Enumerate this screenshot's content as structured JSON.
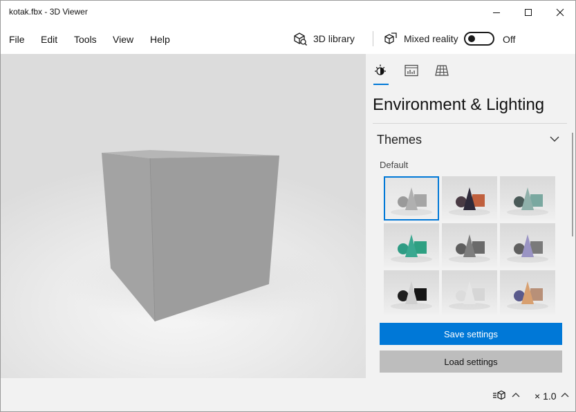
{
  "window": {
    "title": "kotak.fbx - 3D Viewer"
  },
  "menu": {
    "items": [
      "File",
      "Edit",
      "Tools",
      "View",
      "Help"
    ]
  },
  "toolbar": {
    "library_label": "3D library",
    "mixed_reality_label": "Mixed reality",
    "toggle_state": "Off"
  },
  "panel": {
    "tabs": [
      "environment-lighting-icon",
      "stats-icon",
      "grid-icon"
    ],
    "title": "Environment & Lighting",
    "section": "Themes",
    "sub_label": "Default",
    "themes": [
      {
        "name": "default",
        "accent": "#9a9a9a",
        "sphere": "#9a9a9a",
        "cone": "#b0b0b0",
        "box": "#a6a6a6"
      },
      {
        "name": "dark-orange",
        "accent": "#c06a4a",
        "sphere": "#4a3b44",
        "cone": "#2e2a3a",
        "box": "#c0603e"
      },
      {
        "name": "teal",
        "accent": "#7aa8a0",
        "sphere": "#4a5a58",
        "cone": "#8fb0aa",
        "box": "#7aa8a0"
      },
      {
        "name": "green",
        "accent": "#2e9c84",
        "sphere": "#2e9c84",
        "cone": "#3aa890",
        "box": "#2ea082"
      },
      {
        "name": "grey-dark",
        "accent": "#6e6e6e",
        "sphere": "#5e5e5e",
        "cone": "#7e7e7e",
        "box": "#6a6a6a"
      },
      {
        "name": "purple",
        "accent": "#8c86b0",
        "sphere": "#606060",
        "cone": "#9a94c4",
        "box": "#7a7a7a"
      },
      {
        "name": "black",
        "accent": "#1e1e1e",
        "sphere": "#1e1e1e",
        "cone": "#cfcfcf",
        "box": "#141414"
      },
      {
        "name": "white",
        "accent": "#e0e0e0",
        "sphere": "#dcdcdc",
        "cone": "#e6e6e6",
        "box": "#d6d6d6"
      },
      {
        "name": "gold",
        "accent": "#c89a70",
        "sphere": "#5a5a8c",
        "cone": "#d8a070",
        "box": "#b89078"
      }
    ],
    "save_label": "Save settings",
    "load_label": "Load settings"
  },
  "status": {
    "zoom": "× 1.0"
  },
  "colors": {
    "accent": "#0078d7",
    "cube": "#9f9f9f"
  }
}
